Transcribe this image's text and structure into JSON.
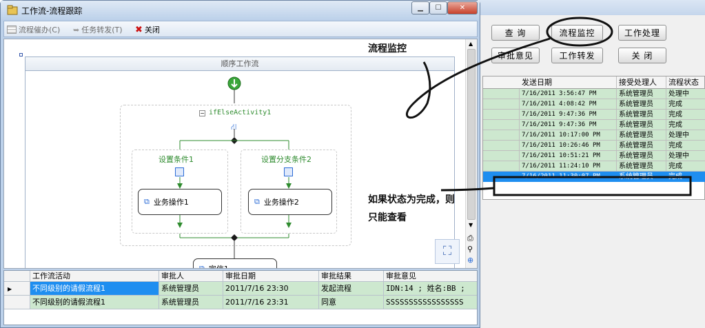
{
  "window": {
    "title": "工作流-流程跟踪"
  },
  "toolbar": {
    "urge": "流程催办(C)",
    "transfer": "任务转发(T)",
    "close": "关闭"
  },
  "designer": {
    "sequence_title": "顺序工作流",
    "ifelse_name": "ifElseActivity1",
    "branch1_label": "设置条件1",
    "branch2_label": "设置分支条件2",
    "act1": "业务操作1",
    "act2": "业务操作2",
    "bottom_act": "完信1"
  },
  "grid": {
    "headers": [
      "工作流活动",
      "审批人",
      "审批日期",
      "审批结果",
      "审批意见"
    ],
    "rows": [
      [
        "不同级别的请假流程1",
        "系统管理员",
        "2011/7/16 23:30",
        "发起流程",
        "IDN:14  ; 姓名:BB  ;"
      ],
      [
        "不同级别的请假流程1",
        "系统管理员",
        "2011/7/16 23:31",
        "同意",
        "SSSSSSSSSSSSSSSSS"
      ]
    ]
  },
  "bg_app": {
    "buttons": [
      "查 询",
      "流程监控",
      "工作处理",
      "审批意见",
      "工作转发",
      "关 闭"
    ],
    "headers": [
      "发送日期",
      "接受处理人",
      "流程状态"
    ],
    "rows": [
      [
        "7/16/2011 3:56:47 PM",
        "系统管理员",
        "处理中"
      ],
      [
        "7/16/2011 4:08:42 PM",
        "系统管理员",
        "完成"
      ],
      [
        "7/16/2011 9:47:36 PM",
        "系统管理员",
        "完成"
      ],
      [
        "7/16/2011 9:47:36 PM",
        "系统管理员",
        "完成"
      ],
      [
        "7/16/2011 10:17:00 PM",
        "系统管理员",
        "处理中"
      ],
      [
        "7/16/2011 10:26:46 PM",
        "系统管理员",
        "完成"
      ],
      [
        "7/16/2011 10:51:21 PM",
        "系统管理员",
        "处理中"
      ],
      [
        "7/16/2011 11:24:10 PM",
        "系统管理员",
        "完成"
      ],
      [
        "7/16/2011 11:30:07 PM",
        "系统管理员",
        "完成"
      ]
    ]
  },
  "annotations": {
    "label1": "流程监控",
    "label2_line1": "如果状态为完成，则",
    "label2_line2": "只能查看"
  },
  "colors": {
    "row_green": "#cde8cf",
    "selected": "#1e8ef0",
    "accent": "#0a5fb3"
  }
}
